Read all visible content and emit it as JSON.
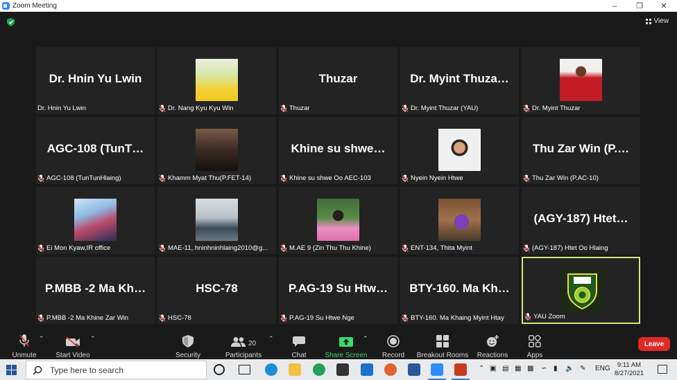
{
  "window": {
    "title": "Zoom Meeting"
  },
  "meeting": {
    "view_label": "View",
    "tiles": [
      {
        "name": "Dr. Hnin Yu Lwin",
        "big": "Dr. Hnin Yu Lwin",
        "muted": false,
        "photo": null,
        "active": false
      },
      {
        "name": "Dr. Nang Kyu Kyu Win",
        "big": "",
        "muted": true,
        "photo": "yellow",
        "active": false
      },
      {
        "name": "Thuzar",
        "big": "Thuzar",
        "muted": true,
        "photo": null,
        "active": false
      },
      {
        "name": "Dr. Myint Thuzar (YAU)",
        "big": "Dr. Myint Thuza…",
        "muted": true,
        "photo": null,
        "active": false
      },
      {
        "name": "Dr. Myint Thuzar",
        "big": "",
        "muted": true,
        "photo": "red",
        "active": false
      },
      {
        "name": "AGC-108 (TunTunHlaing)",
        "big": "AGC-108 (TunT…",
        "muted": true,
        "photo": null,
        "active": false
      },
      {
        "name": "Khamm Myat Thu(P.FET-14)",
        "big": "",
        "muted": true,
        "photo": "dark",
        "active": false
      },
      {
        "name": "Khine su shwe Oo AEC-103",
        "big": "Khine su shwe…",
        "muted": true,
        "photo": null,
        "active": false
      },
      {
        "name": "Nyein Nyein Htwe",
        "big": "",
        "muted": true,
        "photo": "light",
        "active": false
      },
      {
        "name": "Thu Zar Win (P.AC-10)",
        "big": "Thu Zar Win (P.…",
        "muted": true,
        "photo": null,
        "active": false
      },
      {
        "name": "Ei Mon Kyaw,IR office",
        "big": "",
        "muted": true,
        "photo": "blue",
        "active": false
      },
      {
        "name": "MAE-11, hninhninhlaing2010@g...",
        "big": "",
        "muted": true,
        "photo": "office",
        "active": false
      },
      {
        "name": "M.AE 9 (Zin Thu Thu Khine)",
        "big": "",
        "muted": true,
        "photo": "pink",
        "active": false
      },
      {
        "name": "ENT-134, Thita Myint",
        "big": "",
        "muted": true,
        "photo": "purple",
        "active": false
      },
      {
        "name": "(AGY-187) Htet Oo Hlaing",
        "big": "(AGY-187)  Htet…",
        "muted": true,
        "photo": null,
        "active": false
      },
      {
        "name": "P.MBB -2 Ma Khine Zar Win",
        "big": "P.MBB -2 Ma Kh…",
        "muted": true,
        "photo": null,
        "active": false
      },
      {
        "name": "HSC-78",
        "big": "HSC-78",
        "muted": true,
        "photo": null,
        "active": false
      },
      {
        "name": "P.AG-19 Su Htwe Nge",
        "big": "P.AG-19  Su Htw…",
        "muted": true,
        "photo": null,
        "active": false
      },
      {
        "name": "BTY-160. Ma Khaing Myint Htay",
        "big": "BTY-160.  Ma Kh…",
        "muted": true,
        "photo": null,
        "active": false
      },
      {
        "name": "YAU Zoom",
        "big": "",
        "muted": true,
        "photo": "logo",
        "active": true
      }
    ]
  },
  "toolbar": {
    "unmute": "Unmute",
    "start_video": "Start Video",
    "security": "Security",
    "participants": "Participants",
    "participant_count": "20",
    "chat": "Chat",
    "share_screen": "Share Screen",
    "record": "Record",
    "breakout": "Breakout Rooms",
    "reactions": "Reactions",
    "apps": "Apps",
    "leave": "Leave"
  },
  "taskbar": {
    "search_placeholder": "Type here to search",
    "language": "ENG",
    "time": "9:11 AM",
    "date": "8/27/2021"
  },
  "colors": {
    "active_border": "#d2e87a",
    "leave": "#e02828",
    "share_green": "#3fd66a",
    "mute_red": "#e0393e"
  }
}
